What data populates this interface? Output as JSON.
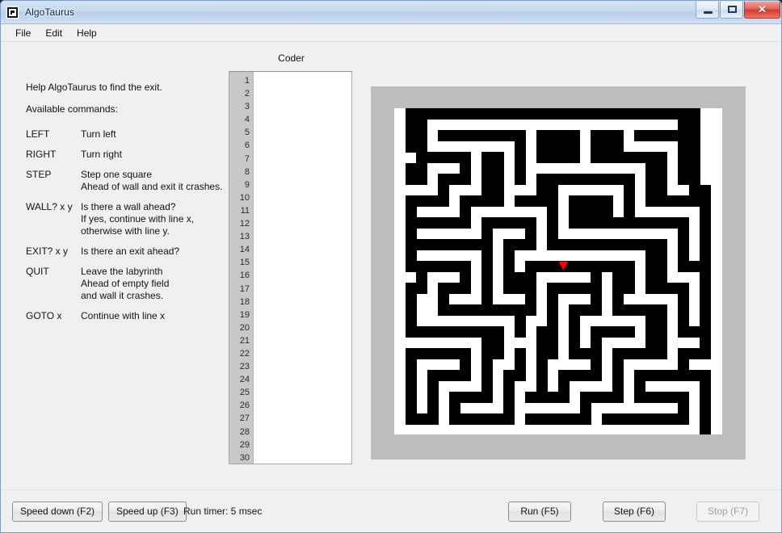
{
  "window": {
    "title": "AlgoTaurus",
    "icon": "maze-logo-icon",
    "minimize_label": "",
    "maximize_label": "",
    "close_label": "✕"
  },
  "menu": {
    "items": [
      {
        "label": "File"
      },
      {
        "label": "Edit"
      },
      {
        "label": "Help"
      }
    ]
  },
  "instructions": {
    "intro": "Help AlgoTaurus to find the exit.",
    "subtitle": "Available commands:",
    "commands": [
      {
        "cmd": "LEFT",
        "desc": [
          "Turn left"
        ]
      },
      {
        "cmd": "RIGHT",
        "desc": [
          "Turn right"
        ]
      },
      {
        "cmd": "STEP",
        "desc": [
          "Step one square",
          "Ahead of wall and exit it crashes."
        ]
      },
      {
        "cmd": "WALL? x y",
        "desc": [
          "Is there a wall ahead?",
          "If yes, continue with line x,",
          "otherwise with line y."
        ]
      },
      {
        "cmd": "EXIT? x y",
        "desc": [
          "Is there an exit ahead?"
        ]
      },
      {
        "cmd": "QUIT",
        "desc": [
          "Leave the labyrinth",
          "Ahead of empty field",
          "and wall it crashes."
        ]
      },
      {
        "cmd": "GOTO x",
        "desc": [
          "Continue with line x"
        ]
      }
    ]
  },
  "coder": {
    "title": "Coder",
    "line_count": 30,
    "code_text": "",
    "placeholder": ""
  },
  "maze": {
    "background_color": "#bdbdbd",
    "wall_color": "#000000",
    "path_color": "#ffffff",
    "player_color": "#ff0000",
    "player_direction": "down",
    "player_col": 15,
    "player_row": 14,
    "cell_size": 13.5,
    "cols": 30,
    "rows": 30,
    "grid": [
      "100000000000000000000000000011",
      "100111111111111111111111110011",
      "100100000000100001000100000011",
      "100111111110100001000111110011",
      "110000010010100001000000010011",
      "100111010010111111111110010011",
      "100100010010100000000010010011",
      "111101110011100111111010011001",
      "100001000010000100001010000001",
      "101111011111110100001011111101",
      "100000010000010100000000000101",
      "101111110111010111111111110101",
      "100000000100010000000000010101",
      "101111110101111111111110010101",
      "100000010101000000000010010001",
      "110111010100011111010010011101",
      "100100010100010000010010000101",
      "101101110111010111010111110101",
      "101100000000010100010000010101",
      "101111111110110101111110010101",
      "100000000010100101000010010001",
      "111111110011100101011110011101",
      "100000010010100100010000010001",
      "101111010110101111010111110111",
      "101000010100101000010100000001",
      "101011110101101011110101111101",
      "101010000101000010000100000101",
      "101010111101111110111111110101",
      "100010000001000000100000000101",
      "111111111111111111111111111101"
    ]
  },
  "toolbar": {
    "speed_down_label": "Speed down (F2)",
    "speed_up_label": "Speed up (F3)",
    "status": "Run timer: 5 msec",
    "run_label": "Run (F5)",
    "step_label": "Step (F6)",
    "stop_label": "Stop (F7)",
    "stop_enabled": false
  }
}
